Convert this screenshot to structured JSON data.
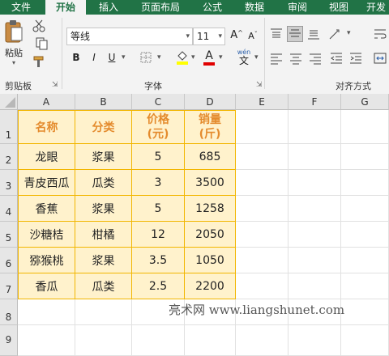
{
  "tabs": [
    "文件",
    "开始",
    "插入",
    "页面布局",
    "公式",
    "数据",
    "审阅",
    "视图",
    "开发"
  ],
  "ribbon": {
    "clipboard": {
      "paste_label": "粘贴",
      "group_label": "剪贴板"
    },
    "font": {
      "font_name": "等线",
      "font_size": "11",
      "bold": "B",
      "italic": "I",
      "underline": "U",
      "font_color_letter": "A",
      "group_label": "字体",
      "phonetic": "wén"
    },
    "alignment": {
      "group_label": "对齐方式"
    }
  },
  "columns": [
    "A",
    "B",
    "C",
    "D",
    "E",
    "F",
    "G"
  ],
  "rows": [
    "1",
    "2",
    "3",
    "4",
    "5",
    "6",
    "7",
    "8",
    "9"
  ],
  "table": {
    "headers": [
      "名称",
      "分类",
      "价格\n(元)",
      "销量\n(斤)"
    ],
    "data": [
      [
        "龙眼",
        "浆果",
        "5",
        "685"
      ],
      [
        "青皮西瓜",
        "瓜类",
        "3",
        "3500"
      ],
      [
        "香蕉",
        "浆果",
        "5",
        "1258"
      ],
      [
        "沙糖桔",
        "柑橘",
        "12",
        "2050"
      ],
      [
        "猕猴桃",
        "浆果",
        "3.5",
        "1050"
      ],
      [
        "香瓜",
        "瓜类",
        "2.5",
        "2200"
      ]
    ]
  },
  "watermark": "亮术网 www.liangshunet.com",
  "colors": {
    "excel_green": "#217346",
    "table_fill": "#fff2cc",
    "table_border": "#f2b600",
    "header_text": "#e48b2d"
  }
}
